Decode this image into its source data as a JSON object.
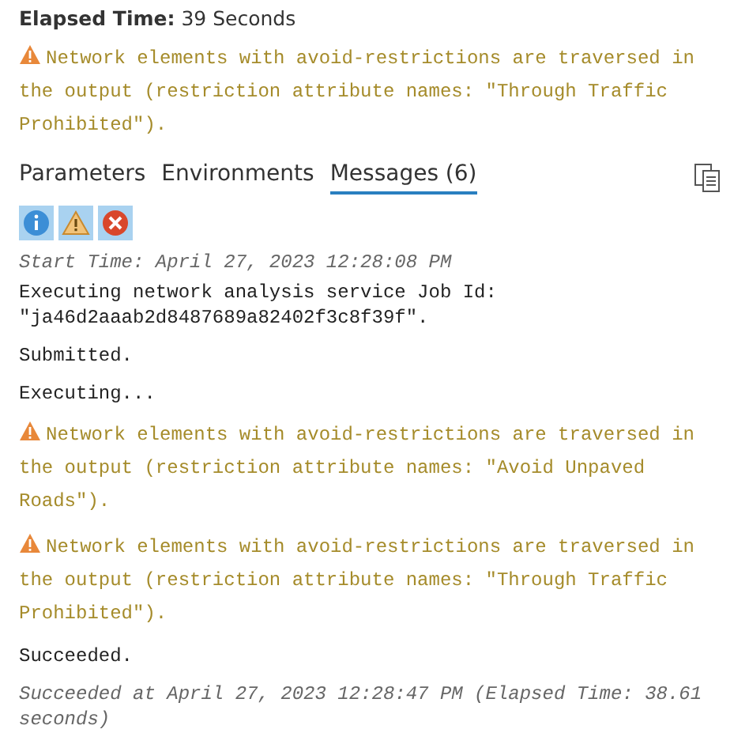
{
  "elapsed": {
    "label": "Elapsed Time:",
    "value": "39 Seconds"
  },
  "summary_warning": "Network elements with avoid-restrictions are traversed in the output (restriction attribute names: \"Through Traffic Prohibited\").",
  "tabs": [
    {
      "label": "Parameters",
      "selected": false
    },
    {
      "label": "Environments",
      "selected": false
    },
    {
      "label": "Messages (6)",
      "selected": true
    }
  ],
  "filters": [
    {
      "kind": "info",
      "selected": true
    },
    {
      "kind": "warning",
      "selected": true
    },
    {
      "kind": "error",
      "selected": true
    }
  ],
  "messages": [
    {
      "kind": "timestamp",
      "text": "Start Time: April 27, 2023 12:28:08 PM"
    },
    {
      "kind": "info",
      "text": "Executing network analysis service Job Id: \"ja46d2aaab2d8487689a82402f3c8f39f\"."
    },
    {
      "kind": "info",
      "text": "Submitted."
    },
    {
      "kind": "info",
      "text": "Executing..."
    },
    {
      "kind": "warning",
      "text": "Network elements with avoid-restrictions are traversed in the output (restriction attribute names: \"Avoid Unpaved Roads\")."
    },
    {
      "kind": "warning",
      "text": "Network elements with avoid-restrictions are traversed in the output (restriction attribute names: \"Through Traffic Prohibited\")."
    },
    {
      "kind": "info",
      "text": "Succeeded."
    },
    {
      "kind": "timestamp",
      "text": "Succeeded at April 27, 2023 12:28:47 PM (Elapsed Time: 38.61 seconds)"
    }
  ]
}
